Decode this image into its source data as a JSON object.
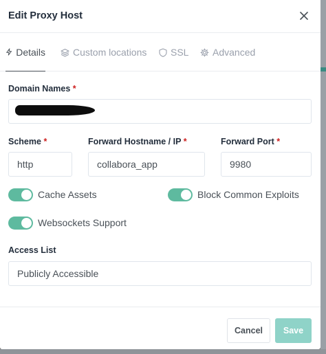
{
  "modal": {
    "title": "Edit Proxy Host"
  },
  "tabs": [
    {
      "label": "Details",
      "icon": "lightning-icon",
      "active": true
    },
    {
      "label": "Custom locations",
      "icon": "layers-icon",
      "active": false
    },
    {
      "label": "SSL",
      "icon": "shield-icon",
      "active": false
    },
    {
      "label": "Advanced",
      "icon": "gear-icon",
      "active": false
    }
  ],
  "form": {
    "required_mark": "*",
    "domain_names": {
      "label": "Domain Names",
      "value": ""
    },
    "scheme": {
      "label": "Scheme",
      "value": "http"
    },
    "forward_host": {
      "label": "Forward Hostname / IP",
      "value": "collabora_app"
    },
    "forward_port": {
      "label": "Forward Port",
      "value": "9980"
    },
    "toggles": [
      {
        "label": "Cache Assets",
        "on": true
      },
      {
        "label": "Block Common Exploits",
        "on": true
      },
      {
        "label": "Websockets Support",
        "on": true
      }
    ],
    "access_list": {
      "label": "Access List",
      "value": "Publicly Accessible"
    }
  },
  "footer": {
    "cancel_label": "Cancel",
    "save_label": "Save"
  },
  "colors": {
    "toggle_on": "#5eba9f",
    "save_button": "#8fd3c8",
    "required": "#cd201f"
  }
}
